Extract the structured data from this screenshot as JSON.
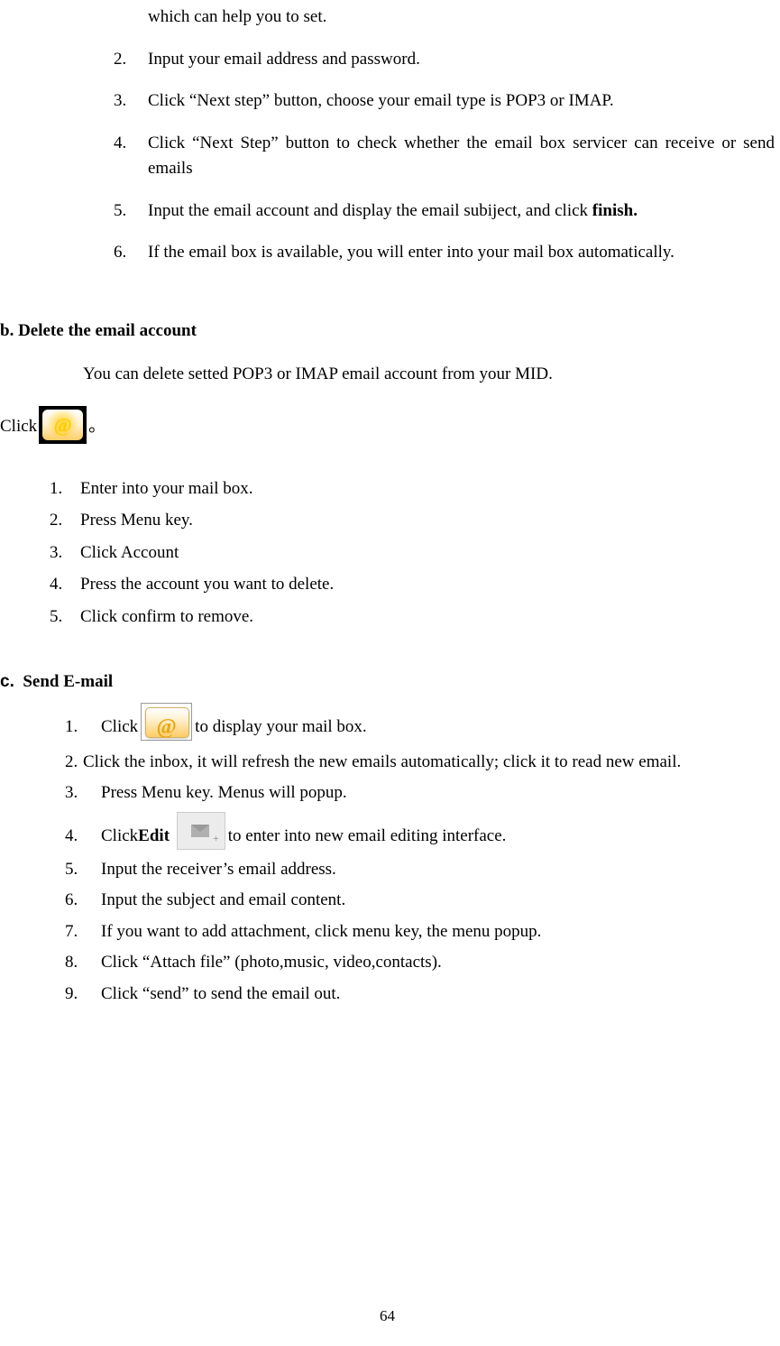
{
  "sectionA": {
    "pre": "which can help you to set.",
    "items": [
      {
        "marker": "2.",
        "text": "Input your email address and password."
      },
      {
        "marker": "3.",
        "text": "Click “Next step” button, choose your email type is POP3 or IMAP."
      },
      {
        "marker": "4.",
        "text": "Click “Next Step” button to check whether the email box servicer can receive or send emails"
      },
      {
        "marker": "5.",
        "prefix": "Input the email account and display the email subiject, and click ",
        "bold": "finish."
      },
      {
        "marker": "6.",
        "text": "If the email box is available, you will enter into your mail box automatically."
      }
    ]
  },
  "sectionB": {
    "heading": "b. Delete the email account",
    "para": "You can delete setted POP3 or IMAP email account from your MID.",
    "click": "Click",
    "clickSuffix": "。",
    "items": [
      {
        "marker": "1.",
        "text": "Enter into your mail box."
      },
      {
        "marker": "2.",
        "text": "Press Menu key."
      },
      {
        "marker": "3.",
        "text": "Click Account"
      },
      {
        "marker": "4.",
        "text": "Press the account you want to delete."
      },
      {
        "marker": "5.",
        "text": "Click confirm to remove."
      }
    ]
  },
  "sectionC": {
    "prefix": "c.",
    "heading": "Send E-mail",
    "items": [
      {
        "marker": "1.",
        "before": "Click ",
        "after": "  to display your mail box."
      },
      {
        "marker": "2.",
        "text": "Click the inbox, it will refresh the new emails automatically; click it to read new email."
      },
      {
        "marker": "3.",
        "text": "Press Menu key. Menus will popup."
      },
      {
        "marker": "4.",
        "before": "Click ",
        "bold": "Edit",
        "after": "  to enter into new email editing interface."
      },
      {
        "marker": "5.",
        "text": "Input the receiver’s email address."
      },
      {
        "marker": "6.",
        "text": "Input the subject and email content."
      },
      {
        "marker": "7.",
        "text": "If you want to add attachment, click menu key, the menu popup."
      },
      {
        "marker": "8.",
        "text": "Click “Attach file” (photo,music, video,contacts)."
      },
      {
        "marker": "9.",
        "text": "Click “send” to send the email out."
      }
    ]
  },
  "pageNumber": "64"
}
